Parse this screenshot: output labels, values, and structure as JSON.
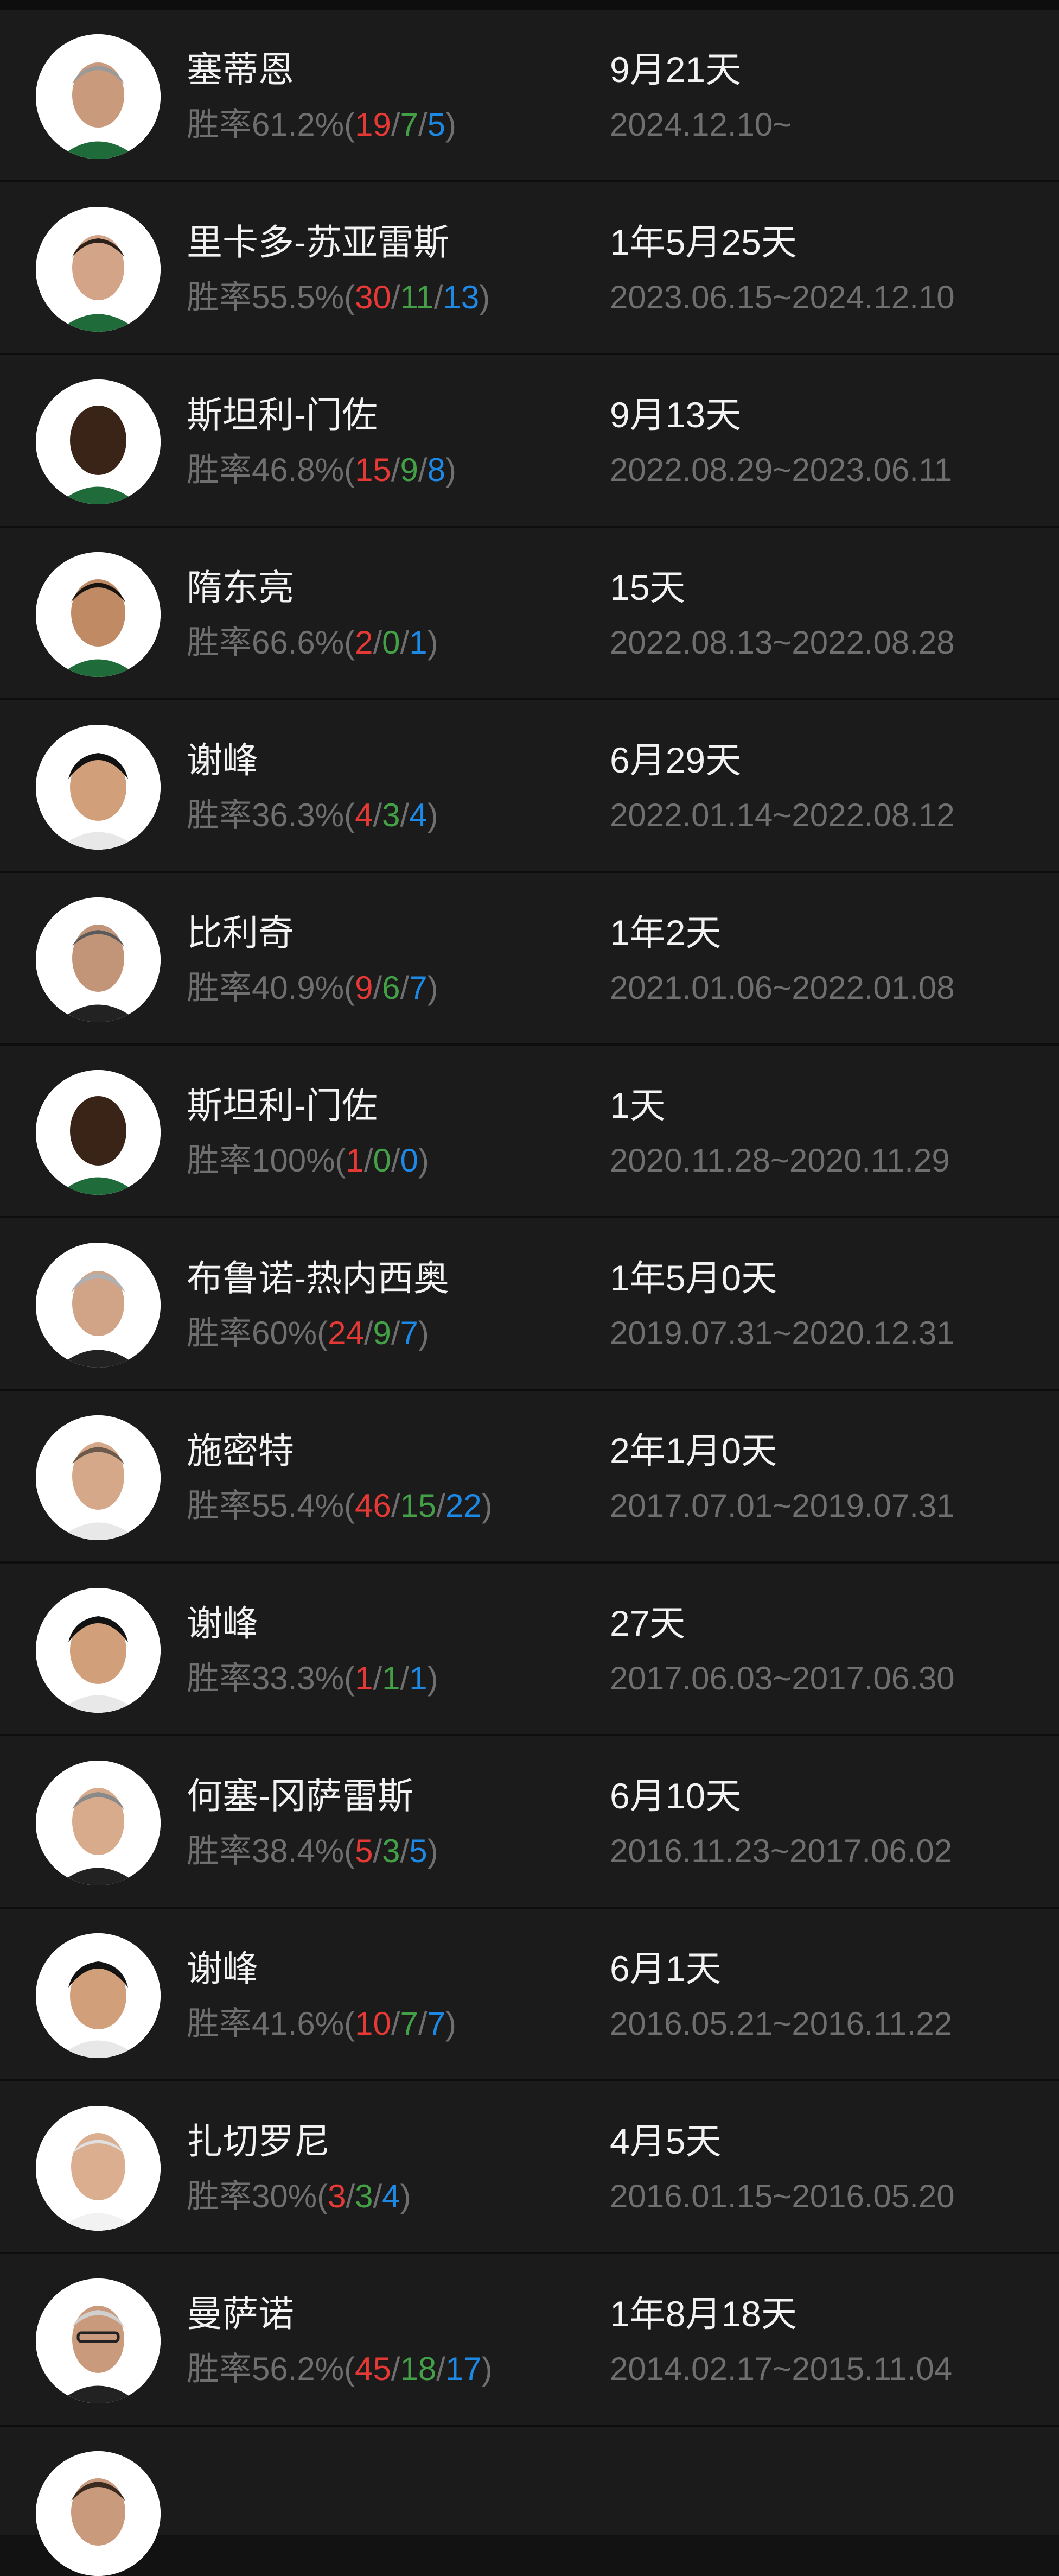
{
  "colors": {
    "background": "#1b1b1b",
    "separator": "#0d0d0d",
    "primary_text": "#f2f2f2",
    "secondary_text": "#6f6f6f",
    "wins": "#e53935",
    "draws": "#43a047",
    "losses": "#1e88e5"
  },
  "coaches": [
    {
      "name": "塞蒂恩",
      "rate_label": "胜率61.2%",
      "open": "(",
      "wins": "19",
      "draws": "7",
      "losses": "5",
      "close": ")",
      "sep1": "/",
      "sep2": "/",
      "duration": "9月21天",
      "period": "2024.12.10~",
      "avatar_icon": "coach-portrait-icon"
    },
    {
      "name": "里卡多-苏亚雷斯",
      "rate_label": "胜率55.5%",
      "open": "(",
      "wins": "30",
      "draws": "11",
      "losses": "13",
      "close": ")",
      "sep1": "/",
      "sep2": "/",
      "duration": "1年5月25天",
      "period": "2023.06.15~2024.12.10",
      "avatar_icon": "coach-portrait-icon"
    },
    {
      "name": "斯坦利-门佐",
      "rate_label": "胜率46.8%",
      "open": "(",
      "wins": "15",
      "draws": "9",
      "losses": "8",
      "close": ")",
      "sep1": "/",
      "sep2": "/",
      "duration": "9月13天",
      "period": "2022.08.29~2023.06.11",
      "avatar_icon": "coach-portrait-icon"
    },
    {
      "name": "隋东亮",
      "rate_label": "胜率66.6%",
      "open": "(",
      "wins": "2",
      "draws": "0",
      "losses": "1",
      "close": ")",
      "sep1": "/",
      "sep2": "/",
      "duration": "15天",
      "period": "2022.08.13~2022.08.28",
      "avatar_icon": "coach-portrait-icon"
    },
    {
      "name": "谢峰",
      "rate_label": "胜率36.3%",
      "open": "(",
      "wins": "4",
      "draws": "3",
      "losses": "4",
      "close": ")",
      "sep1": "/",
      "sep2": "/",
      "duration": "6月29天",
      "period": "2022.01.14~2022.08.12",
      "avatar_icon": "coach-portrait-icon"
    },
    {
      "name": "比利奇",
      "rate_label": "胜率40.9%",
      "open": "(",
      "wins": "9",
      "draws": "6",
      "losses": "7",
      "close": ")",
      "sep1": "/",
      "sep2": "/",
      "duration": "1年2天",
      "period": "2021.01.06~2022.01.08",
      "avatar_icon": "coach-portrait-icon"
    },
    {
      "name": "斯坦利-门佐",
      "rate_label": "胜率100%",
      "open": "(",
      "wins": "1",
      "draws": "0",
      "losses": "0",
      "close": ")",
      "sep1": "/",
      "sep2": "/",
      "duration": "1天",
      "period": "2020.11.28~2020.11.29",
      "avatar_icon": "coach-portrait-icon"
    },
    {
      "name": "布鲁诺-热内西奥",
      "rate_label": "胜率60%",
      "open": "(",
      "wins": "24",
      "draws": "9",
      "losses": "7",
      "close": ")",
      "sep1": "/",
      "sep2": "/",
      "duration": "1年5月0天",
      "period": "2019.07.31~2020.12.31",
      "avatar_icon": "coach-portrait-icon"
    },
    {
      "name": "施密特",
      "rate_label": "胜率55.4%",
      "open": "(",
      "wins": "46",
      "draws": "15",
      "losses": "22",
      "close": ")",
      "sep1": "/",
      "sep2": "/",
      "duration": "2年1月0天",
      "period": "2017.07.01~2019.07.31",
      "avatar_icon": "coach-portrait-icon"
    },
    {
      "name": "谢峰",
      "rate_label": "胜率33.3%",
      "open": "(",
      "wins": "1",
      "draws": "1",
      "losses": "1",
      "close": ")",
      "sep1": "/",
      "sep2": "/",
      "duration": "27天",
      "period": "2017.06.03~2017.06.30",
      "avatar_icon": "coach-portrait-icon"
    },
    {
      "name": "何塞-冈萨雷斯",
      "rate_label": "胜率38.4%",
      "open": "(",
      "wins": "5",
      "draws": "3",
      "losses": "5",
      "close": ")",
      "sep1": "/",
      "sep2": "/",
      "duration": "6月10天",
      "period": "2016.11.23~2017.06.02",
      "avatar_icon": "coach-portrait-icon"
    },
    {
      "name": "谢峰",
      "rate_label": "胜率41.6%",
      "open": "(",
      "wins": "10",
      "draws": "7",
      "losses": "7",
      "close": ")",
      "sep1": "/",
      "sep2": "/",
      "duration": "6月1天",
      "period": "2016.05.21~2016.11.22",
      "avatar_icon": "coach-portrait-icon"
    },
    {
      "name": "扎切罗尼",
      "rate_label": "胜率30%",
      "open": "(",
      "wins": "3",
      "draws": "3",
      "losses": "4",
      "close": ")",
      "sep1": "/",
      "sep2": "/",
      "duration": "4月5天",
      "period": "2016.01.15~2016.05.20",
      "avatar_icon": "coach-portrait-icon"
    },
    {
      "name": "曼萨诺",
      "rate_label": "胜率56.2%",
      "open": "(",
      "wins": "45",
      "draws": "18",
      "losses": "17",
      "close": ")",
      "sep1": "/",
      "sep2": "/",
      "duration": "1年8月18天",
      "period": "2014.02.17~2015.11.04",
      "avatar_icon": "coach-portrait-icon"
    }
  ]
}
